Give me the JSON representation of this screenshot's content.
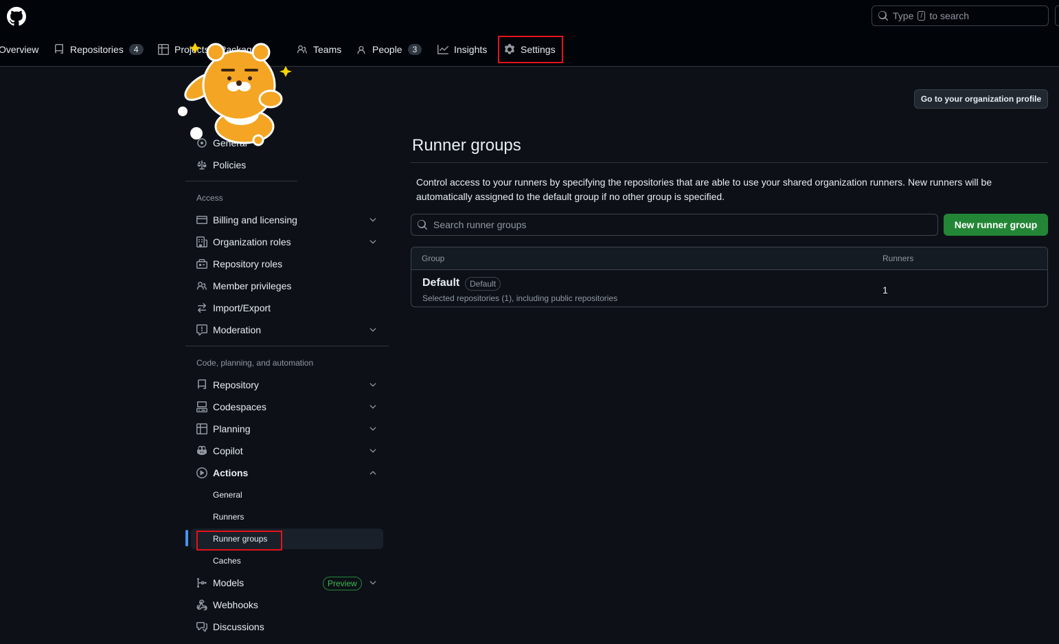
{
  "header": {
    "search_prefix": "Type",
    "search_key": "/",
    "search_suffix": "to search",
    "nav": {
      "overview": "Overview",
      "repositories": "Repositories",
      "repositories_count": "4",
      "projects": "Projects",
      "packages": "Packages",
      "teams": "Teams",
      "people": "People",
      "people_count": "3",
      "insights": "Insights",
      "settings": "Settings"
    }
  },
  "sidebar": {
    "general": "General",
    "policies": "Policies",
    "access_label": "Access",
    "billing": "Billing and licensing",
    "org_roles": "Organization roles",
    "repo_roles": "Repository roles",
    "member_privileges": "Member privileges",
    "import_export": "Import/Export",
    "moderation": "Moderation",
    "code_label": "Code, planning, and automation",
    "repository": "Repository",
    "codespaces": "Codespaces",
    "planning": "Planning",
    "copilot": "Copilot",
    "actions": "Actions",
    "actions_sub": {
      "general": "General",
      "runners": "Runners",
      "runner_groups": "Runner groups",
      "caches": "Caches"
    },
    "models": "Models",
    "preview_badge": "Preview",
    "webhooks": "Webhooks",
    "discussions": "Discussions"
  },
  "main": {
    "profile_button": "Go to your organization profile",
    "title": "Runner groups",
    "description": "Control access to your runners by specifying the repositories that are able to use your shared organization runners. New runners will be automatically assigned to the default group if no other group is specified.",
    "search_placeholder": "Search runner groups",
    "new_button": "New runner group",
    "table": {
      "col_group": "Group",
      "col_runners": "Runners",
      "rows": [
        {
          "name": "Default",
          "badge": "Default",
          "description": "Selected repositories (1), including public repositories",
          "runners": "1"
        }
      ]
    }
  },
  "colors": {
    "background": "#0d1117",
    "header_bg": "#010409",
    "accent_green": "#238636",
    "highlight_red": "#e5121c",
    "active_blue": "#4493f8"
  },
  "icons": [
    "github-logo-icon",
    "search-icon",
    "repo-icon",
    "table-icon",
    "people-icon",
    "person-icon",
    "graph-icon",
    "gear-icon",
    "law-icon",
    "credit-card-icon",
    "organization-icon",
    "id-badge-icon",
    "arrow-switch-icon",
    "report-icon",
    "codespaces-icon",
    "copilot-icon",
    "play-icon",
    "chevron-down-icon",
    "chevron-up-icon",
    "ai-model-icon",
    "webhook-icon",
    "comment-discussion-icon"
  ]
}
